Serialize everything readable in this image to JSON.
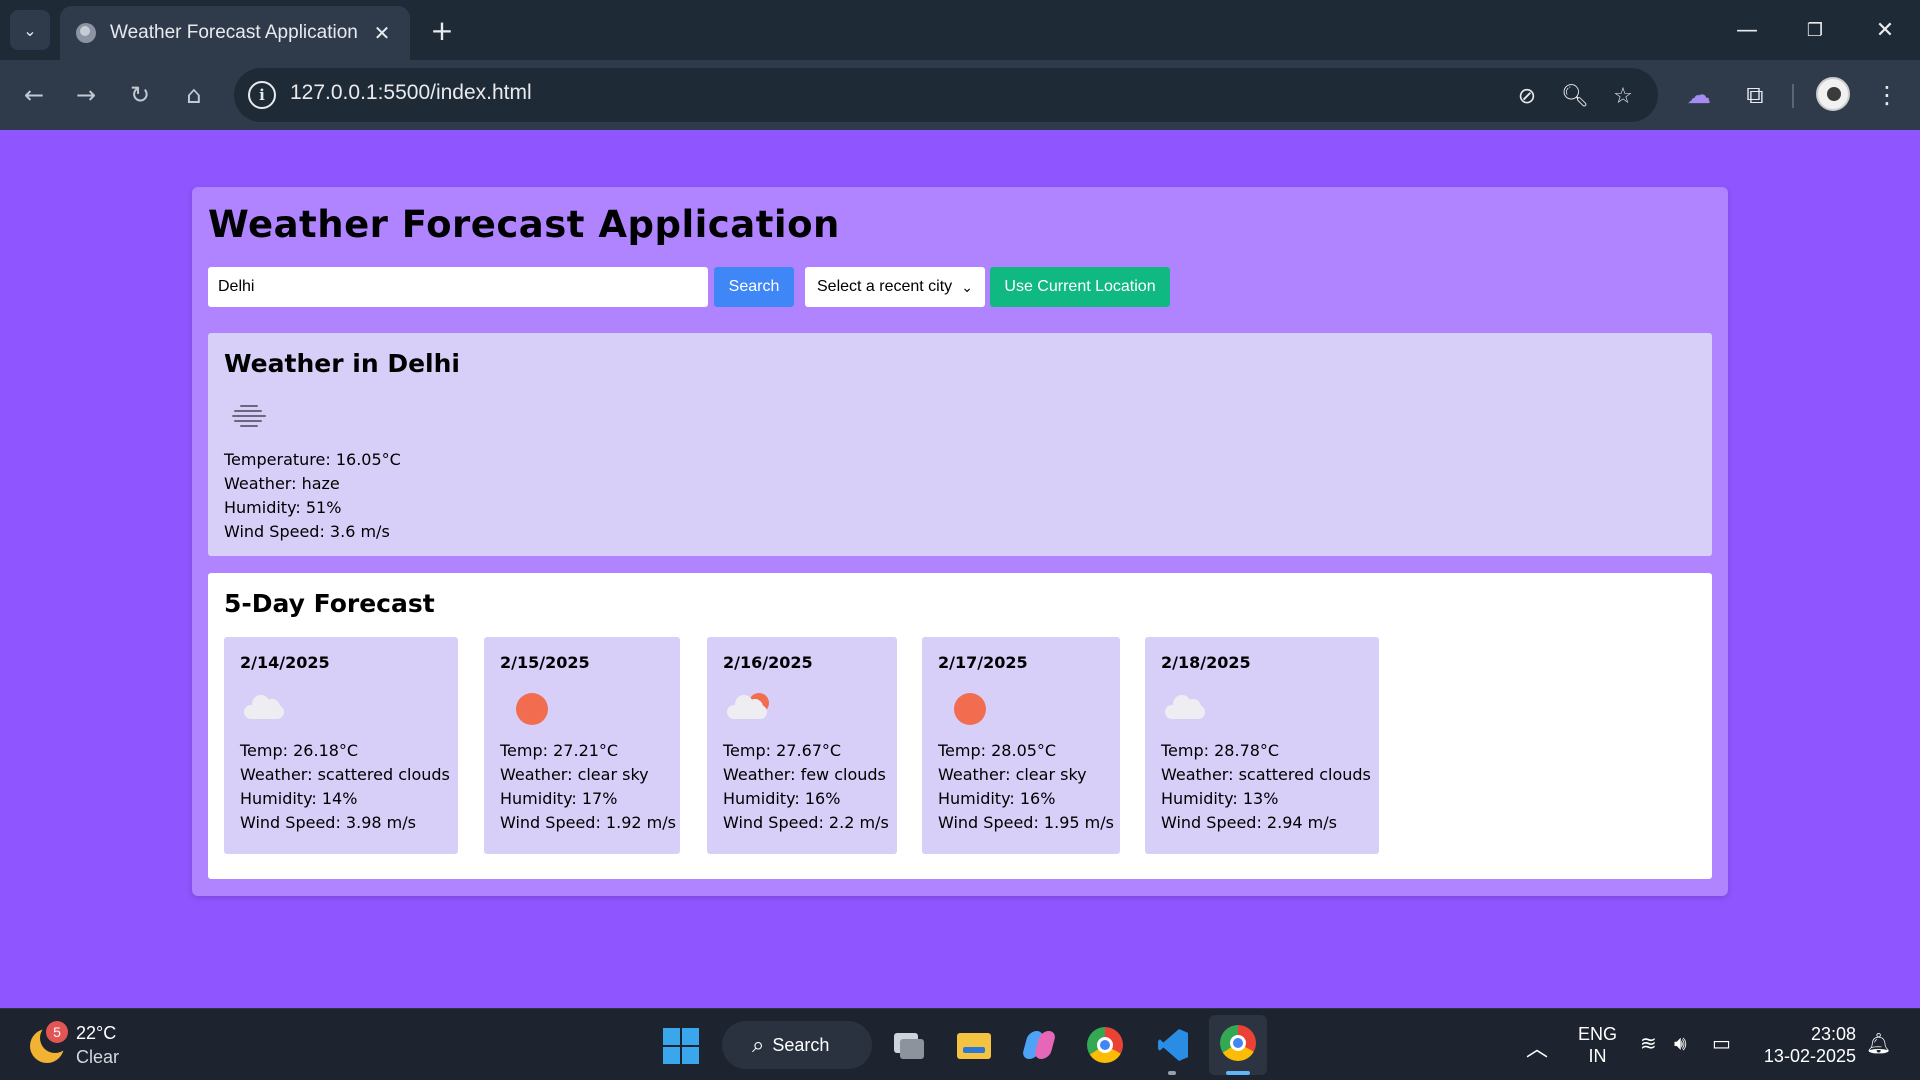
{
  "browser": {
    "tab_title": "Weather Forecast Application",
    "url": "127.0.0.1:5500/index.html"
  },
  "app": {
    "title": "Weather Forecast Application",
    "search": {
      "value": "Delhi",
      "button_label": "Search"
    },
    "recent_select": {
      "selected": "Select a recent city"
    },
    "location_button_label": "Use Current Location",
    "current": {
      "heading": "Weather in Delhi",
      "icon": "haze-icon",
      "temperature": "Temperature: 16.05°C",
      "weather": "Weather: haze",
      "humidity": "Humidity: 51%",
      "wind": "Wind Speed: 3.6 m/s"
    },
    "forecast": {
      "heading": "5-Day Forecast",
      "days": [
        {
          "date": "2/14/2025",
          "icon": "scattered-clouds-icon",
          "temp": "Temp: 26.18°C",
          "weather": "Weather: scattered clouds",
          "humidity": "Humidity: 14%",
          "wind": "Wind Speed: 3.98 m/s"
        },
        {
          "date": "2/15/2025",
          "icon": "clear-sky-icon",
          "temp": "Temp: 27.21°C",
          "weather": "Weather: clear sky",
          "humidity": "Humidity: 17%",
          "wind": "Wind Speed: 1.92 m/s"
        },
        {
          "date": "2/16/2025",
          "icon": "few-clouds-icon",
          "temp": "Temp: 27.67°C",
          "weather": "Weather: few clouds",
          "humidity": "Humidity: 16%",
          "wind": "Wind Speed: 2.2 m/s"
        },
        {
          "date": "2/17/2025",
          "icon": "clear-sky-icon",
          "temp": "Temp: 28.05°C",
          "weather": "Weather: clear sky",
          "humidity": "Humidity: 16%",
          "wind": "Wind Speed: 1.95 m/s"
        },
        {
          "date": "2/18/2025",
          "icon": "scattered-clouds-icon",
          "temp": "Temp: 28.78°C",
          "weather": "Weather: scattered clouds",
          "humidity": "Humidity: 13%",
          "wind": "Wind Speed: 2.94 m/s"
        }
      ]
    }
  },
  "taskbar": {
    "weather_badge": "5",
    "weather_temp": "22°C",
    "weather_desc": "Clear",
    "search_label": "Search",
    "lang_line1": "ENG",
    "lang_line2": "IN",
    "time": "23:08",
    "date": "13-02-2025"
  },
  "colors": {
    "page_background": "#8f55ff",
    "container": "#b084ff",
    "card": "#d7cff8",
    "search_button": "#3f86f7",
    "location_button": "#10b981",
    "sun": "#f26d4f"
  }
}
